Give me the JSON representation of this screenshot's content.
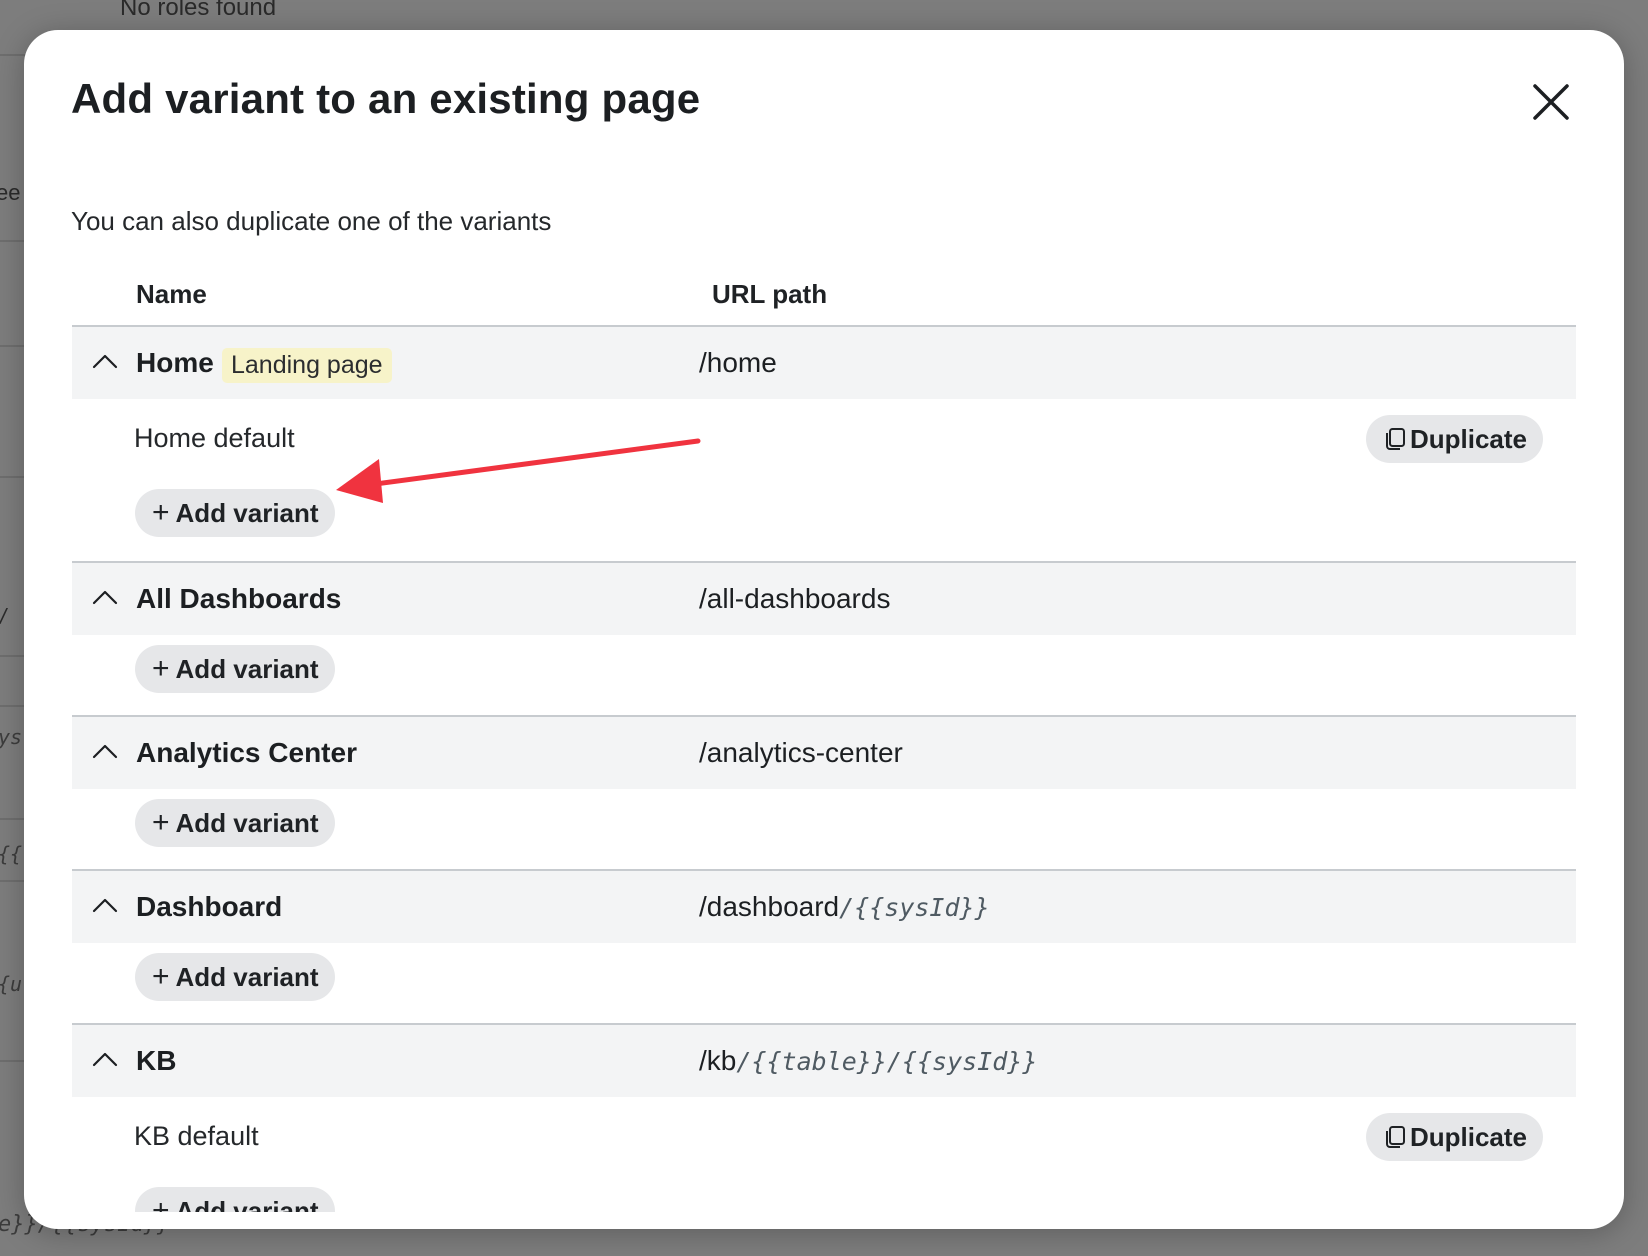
{
  "background": {
    "top_text": "No roles found",
    "left_fragments": [
      "ee",
      "/",
      "ys",
      "{{",
      "{u"
    ],
    "bottom_fragment": "e}}/{{sysId}}"
  },
  "modal": {
    "title": "Add variant to an existing page",
    "subtitle": "You can also duplicate one of the variants",
    "close_label": "×"
  },
  "table": {
    "headers": {
      "name": "Name",
      "url": "URL path"
    },
    "add_variant_label": "Add variant",
    "duplicate_label": "Duplicate",
    "groups": [
      {
        "name": "Home",
        "badge": "Landing page",
        "url": "/home",
        "url_param": "",
        "variants": [
          "Home default"
        ]
      },
      {
        "name": "All Dashboards",
        "badge": "",
        "url": "/all-dashboards",
        "url_param": "",
        "variants": []
      },
      {
        "name": "Analytics Center",
        "badge": "",
        "url": "/analytics-center",
        "url_param": "",
        "variants": []
      },
      {
        "name": "Dashboard",
        "badge": "",
        "url": "/dashboard",
        "url_param": "/{{sysId}}",
        "variants": []
      },
      {
        "name": "KB",
        "badge": "",
        "url": "/kb",
        "url_param": "/{{table}}/{{sysId}}",
        "variants": [
          "KB default"
        ]
      }
    ]
  },
  "colors": {
    "overlay": "#7d7d7d",
    "row_header_bg": "#f3f4f5",
    "pill_bg": "#e6e7e9",
    "badge_bg": "#f7f3c9",
    "annotation_arrow": "#f0333f"
  }
}
